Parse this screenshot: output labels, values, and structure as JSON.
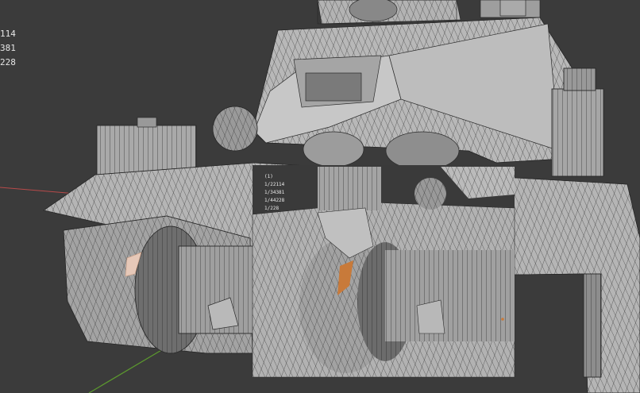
{
  "viewport": {
    "background": "#3b3b3b",
    "axis_x_color": "#b84a4a",
    "axis_y_color": "#5c9a2e",
    "mesh_color": "#a8a8a8",
    "wire_color": "#2a2a2a",
    "selection_color": "#c87a3a"
  },
  "overlay_stats": {
    "lines": [
      "114",
      "381",
      "228",
      ""
    ]
  },
  "inset_stats": {
    "lines": [
      "(1)",
      "1/22114",
      "1/34381",
      "1/44228",
      "1/228"
    ]
  },
  "icons": [
    "viewport-grid-icon"
  ]
}
